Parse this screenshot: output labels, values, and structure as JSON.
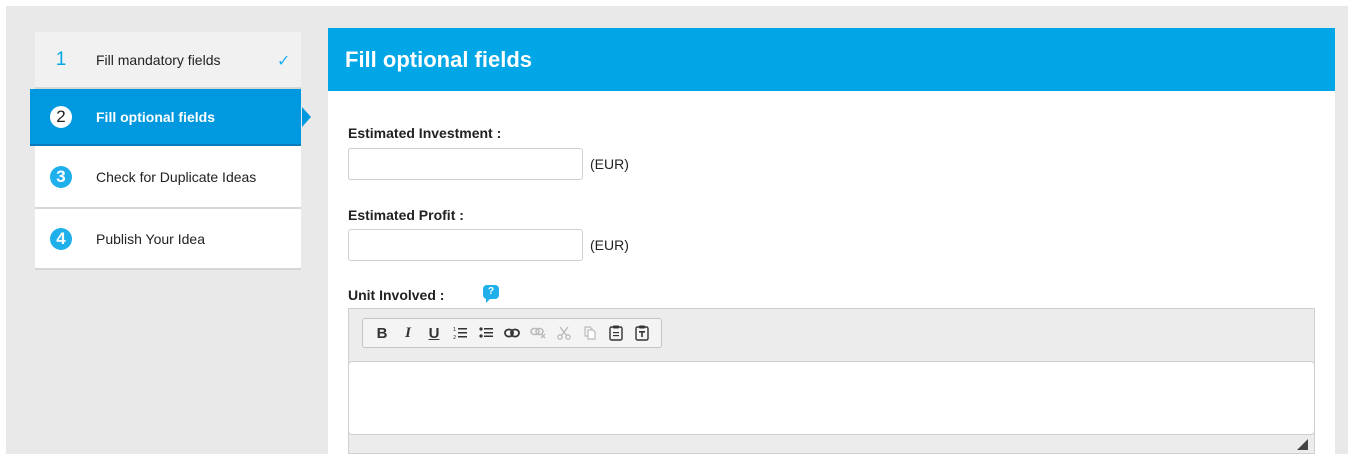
{
  "steps": [
    {
      "number": "1",
      "label": "Fill mandatory fields",
      "state": "done"
    },
    {
      "number": "2",
      "label": "Fill optional fields",
      "state": "active"
    },
    {
      "number": "3",
      "label": "Check for Duplicate Ideas",
      "state": "pending"
    },
    {
      "number": "4",
      "label": "Publish Your Idea",
      "state": "pending"
    }
  ],
  "panel": {
    "title": "Fill optional fields",
    "fields": {
      "investment": {
        "label": "Estimated Investment :",
        "value": "",
        "unit": "(EUR)"
      },
      "profit": {
        "label": "Estimated Profit :",
        "value": "",
        "unit": "(EUR)"
      },
      "unit_involved": {
        "label": "Unit Involved :",
        "help_icon": "question-bubble-icon"
      }
    },
    "editor": {
      "toolbar": [
        "bold",
        "italic",
        "underline",
        "numbered-list",
        "bulleted-list",
        "link",
        "unlink",
        "cut",
        "copy",
        "paste",
        "paste-as-text"
      ],
      "bold_glyph": "B",
      "italic_glyph": "I",
      "underline_glyph": "U",
      "content": ""
    }
  },
  "colors": {
    "accent": "#00a6e6",
    "active_step": "#0099e0",
    "background": "#e9e9e9"
  }
}
